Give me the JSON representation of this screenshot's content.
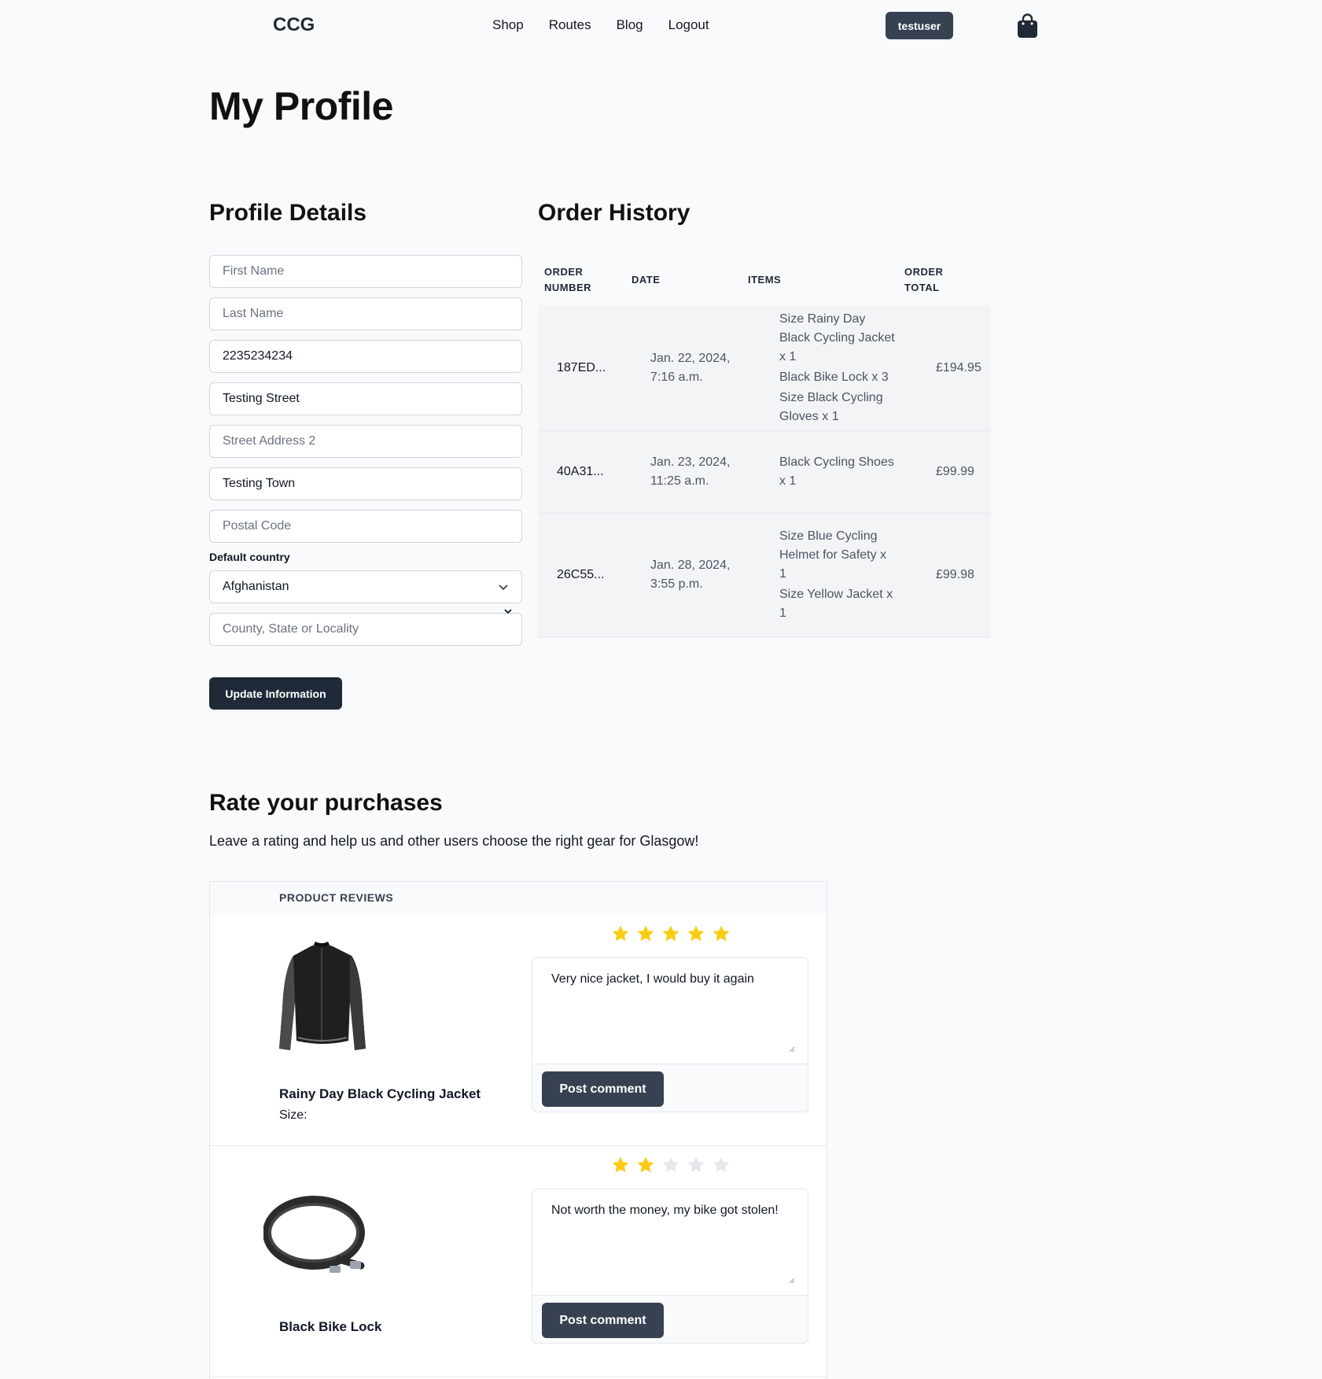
{
  "header": {
    "logo": "CCG",
    "nav": [
      "Shop",
      "Routes",
      "Blog",
      "Logout"
    ],
    "user_button": "testuser",
    "cart_icon": "shopping-bag-icon"
  },
  "page": {
    "title": "My Profile"
  },
  "profile": {
    "title": "Profile Details",
    "fields": {
      "first_name": {
        "placeholder": "First Name",
        "value": ""
      },
      "last_name": {
        "placeholder": "Last Name",
        "value": ""
      },
      "phone": {
        "placeholder": "",
        "value": "2235234234"
      },
      "street1": {
        "placeholder": "",
        "value": "Testing Street"
      },
      "street2": {
        "placeholder": "Street Address 2",
        "value": ""
      },
      "town": {
        "placeholder": "",
        "value": "Testing Town"
      },
      "postal": {
        "placeholder": "Postal Code",
        "value": ""
      },
      "county": {
        "placeholder": "County, State or Locality",
        "value": ""
      }
    },
    "country_label": "Default country",
    "country_value": "Afghanistan",
    "update_button": "Update Information"
  },
  "orders": {
    "title": "Order History",
    "headers": [
      "ORDER NUMBER",
      "DATE",
      "ITEMS",
      "ORDER TOTAL"
    ],
    "rows": [
      {
        "number": "187ED...",
        "date": "Jan. 22, 2024, 7:16 a.m.",
        "items": [
          "Size Rainy Day Black Cycling Jacket x 1",
          "Black Bike Lock x 3",
          "Size Black Cycling Gloves x 1"
        ],
        "total": "£194.95"
      },
      {
        "number": "40A31...",
        "date": "Jan. 23, 2024, 11:25 a.m.",
        "items": [
          "Black Cycling Shoes x 1"
        ],
        "total": "£99.99"
      },
      {
        "number": "26C55...",
        "date": "Jan. 28, 2024, 3:55 p.m.",
        "items": [
          "Size Blue Cycling Helmet for Safety x 1",
          "Size Yellow Jacket x 1"
        ],
        "total": "£99.98"
      }
    ]
  },
  "rating": {
    "title": "Rate your purchases",
    "subtitle": "Leave a rating and help us and other users choose the right gear for Glasgow!",
    "table_header": "PRODUCT REVIEWS",
    "reviews": [
      {
        "product": "Rainy Day Black Cycling Jacket",
        "size_label": "Size:",
        "stars": 5,
        "comment": "Very nice jacket, I would buy it again",
        "button": "Post comment"
      },
      {
        "product": "Black Bike Lock",
        "size_label": "",
        "stars": 2,
        "comment": "Not worth the money, my bike got stolen!",
        "button": "Post comment"
      }
    ]
  },
  "colors": {
    "star_on": "#facc15",
    "star_off": "#e5e7eb",
    "button_dark": "#1f2937",
    "button_slate": "#374151"
  }
}
